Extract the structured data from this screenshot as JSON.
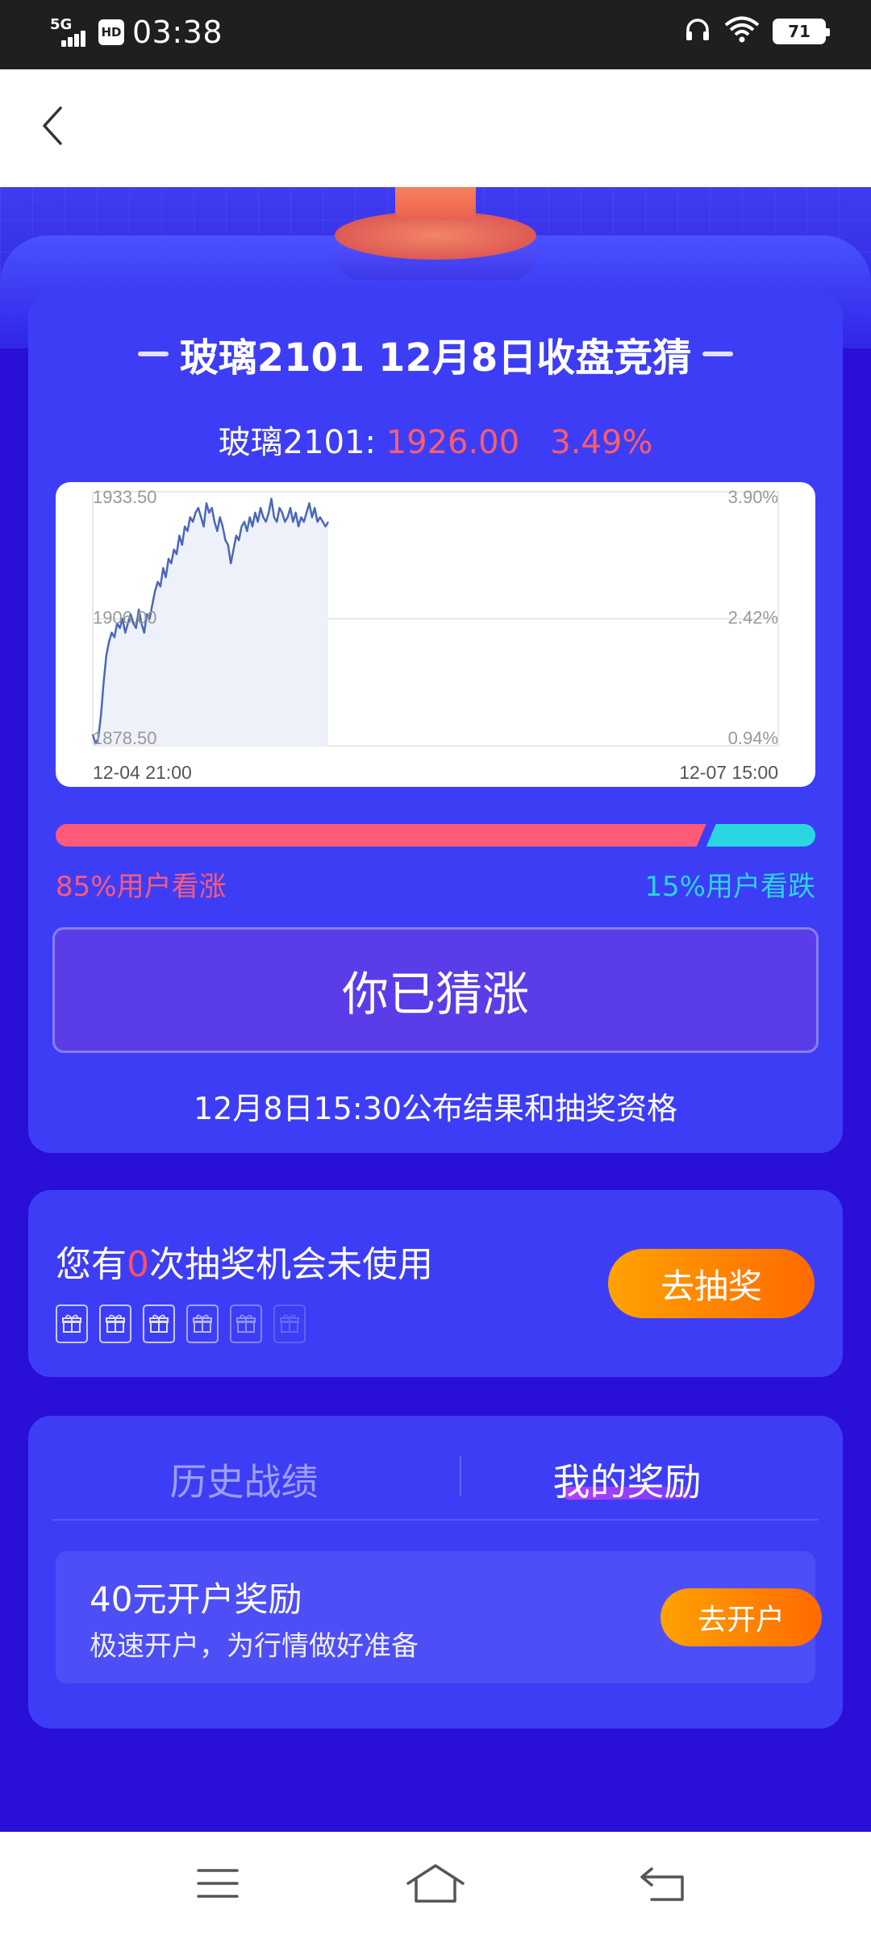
{
  "status_bar": {
    "network": "5G",
    "hd": "HD",
    "time": "03:38",
    "battery": "71"
  },
  "card1": {
    "title": "玻璃2101 12月8日收盘竞猜",
    "price_label": "玻璃2101:",
    "price": "1926.00",
    "change": "3.49%",
    "ratio": {
      "bull_percent": 85,
      "bear_percent": 15,
      "bull_label": "85%用户看涨",
      "bear_label": "15%用户看跌"
    },
    "guess_button": "你已猜涨",
    "announce": "12月8日15:30公布结果和抽奖资格"
  },
  "chart_data": {
    "type": "line",
    "ylim": [
      1878.5,
      1933.5
    ],
    "y_ticks_left": [
      "1933.50",
      "1906.00",
      "1878.50"
    ],
    "y_ticks_right": [
      "3.90%",
      "2.42%",
      "0.94%"
    ],
    "x_labels": [
      "12-04 21:00",
      "12-07 15:00"
    ],
    "series": [
      {
        "values": [
          1881,
          1879,
          1880,
          1885,
          1892,
          1898,
          1901,
          1903,
          1902,
          1905,
          1904,
          1906,
          1903,
          1905,
          1907,
          1905,
          1904,
          1908,
          1905,
          1903,
          1907,
          1906,
          1909,
          1912,
          1914,
          1913,
          1917,
          1915,
          1919,
          1918,
          1921,
          1920,
          1924,
          1922,
          1926,
          1925,
          1928,
          1927,
          1929,
          1930,
          1928,
          1926,
          1931,
          1929,
          1930,
          1927,
          1925,
          1928,
          1926,
          1923,
          1922,
          1918,
          1921,
          1924,
          1923,
          1926,
          1927,
          1925,
          1928,
          1926,
          1929,
          1927,
          1930,
          1928,
          1927,
          1929,
          1932,
          1928,
          1927,
          1930,
          1929,
          1927,
          1928,
          1930,
          1927,
          1929,
          1926,
          1928,
          1927,
          1929,
          1931,
          1928,
          1930,
          1927,
          1928,
          1927,
          1926,
          1927
        ]
      }
    ]
  },
  "card2": {
    "lottery_prefix": "您有",
    "lottery_count": "0",
    "lottery_suffix": "次抽奖机会未使用",
    "draw_button": "去抽奖",
    "gift_count": 6
  },
  "card3": {
    "tab_history": "历史战绩",
    "tab_rewards": "我的奖励",
    "reward_title": "40元开户奖励",
    "reward_subtitle": "极速开户，为行情做好准备",
    "reward_button": "去开户"
  },
  "colors": {
    "bull": "#ff5a78",
    "bear": "#2ad6e0",
    "line": "#4a68b8",
    "area": "#eef1fa"
  },
  "icons": {
    "back": "chevron-left-icon",
    "menu": "menu-icon",
    "home": "home-icon",
    "return": "return-icon",
    "gift": "gift-icon"
  }
}
